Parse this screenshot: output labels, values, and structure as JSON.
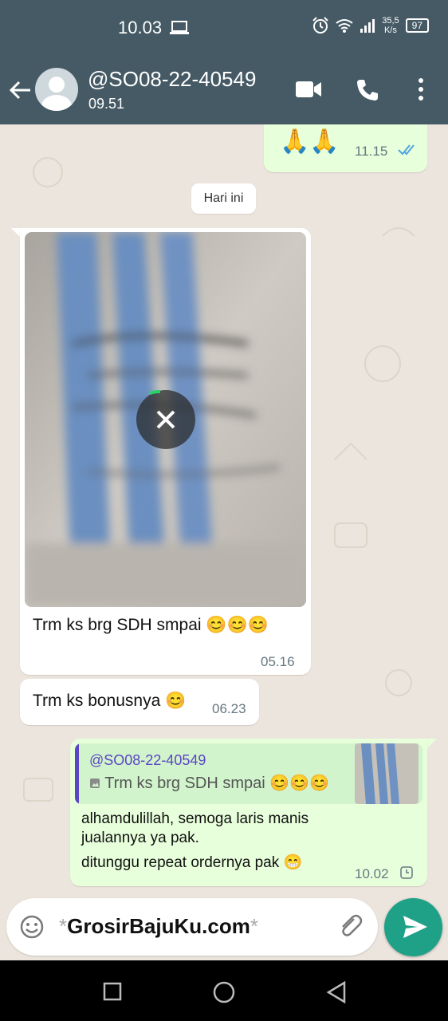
{
  "status_bar": {
    "time": "10.03",
    "net_speed_value": "35,5",
    "net_speed_unit": "K/s",
    "battery": "97"
  },
  "header": {
    "contact_name": "@SO08-22-40549",
    "last_seen": "09.51"
  },
  "messages": [
    {
      "direction": "out",
      "text": "🙏🙏",
      "time": "11.15",
      "status": "read"
    },
    {
      "type": "date",
      "text": "Hari ini"
    },
    {
      "direction": "in",
      "type": "image",
      "caption": "Trm ks brg SDH smpai 😊😊😊",
      "time": "05.16"
    },
    {
      "direction": "in",
      "text": "Trm ks bonusnya 😊",
      "time": "06.23"
    },
    {
      "direction": "out",
      "quote_author": "@SO08-22-40549",
      "quote_text": "Trm ks brg SDH smpai 😊😊😊",
      "line1": "alhamdulillah, semoga laris manis",
      "line2": "jualannya ya pak.",
      "line3": "ditunggu repeat ordernya pak 😁",
      "time": "10.02",
      "status": "pending"
    }
  ],
  "composer": {
    "text": "GrosirBajuKu.com",
    "prefix": "*",
    "suffix": "*"
  },
  "colors": {
    "header": "#455a64",
    "accent": "#1fa187",
    "quote": "#5b45c4",
    "outgoing": "#e7ffdb"
  }
}
